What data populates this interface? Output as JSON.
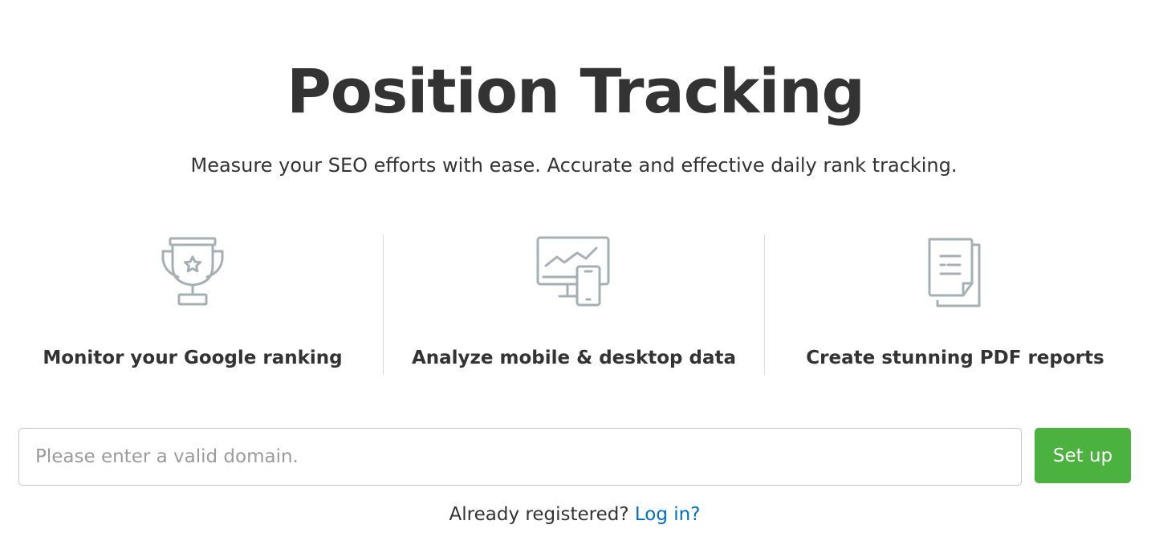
{
  "header": {
    "title": "Position Tracking",
    "subtitle": "Measure your SEO efforts with ease. Accurate and effective daily rank tracking."
  },
  "features": [
    {
      "icon": "trophy-icon",
      "label": "Monitor your Google ranking"
    },
    {
      "icon": "monitor-mobile-icon",
      "label": "Analyze mobile & desktop data"
    },
    {
      "icon": "document-report-icon",
      "label": "Create stunning PDF reports"
    }
  ],
  "form": {
    "domain_placeholder": "Please enter a valid domain.",
    "domain_value": "",
    "setup_label": "Set up"
  },
  "login": {
    "prompt": "Already registered?",
    "link_label": "Log in?"
  },
  "colors": {
    "title_text": "#333333",
    "icon_stroke": "#a5b0b5",
    "button_green": "#4cb23f",
    "link_blue": "#006dca",
    "divider": "#dcdcdc"
  }
}
